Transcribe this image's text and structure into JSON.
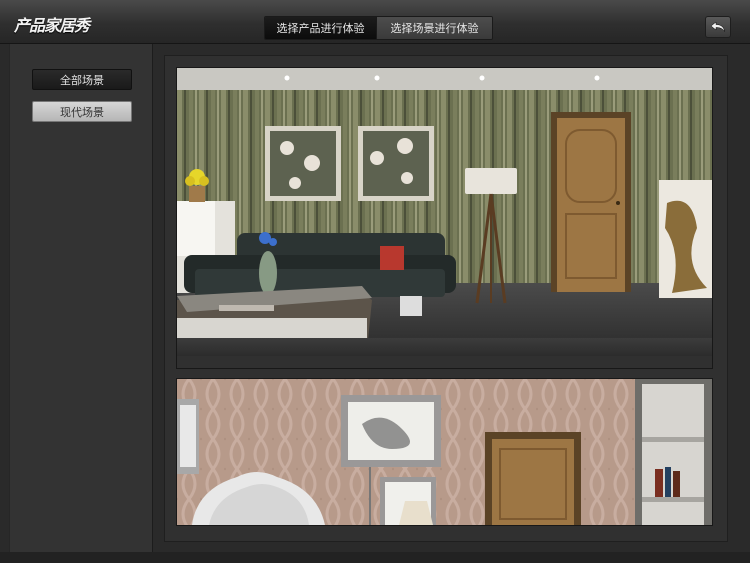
{
  "app": {
    "title": "产品家居秀"
  },
  "header": {
    "tabs": [
      {
        "label": "选择产品进行体验",
        "active": true
      },
      {
        "label": "选择场景进行体验",
        "active": false
      }
    ],
    "back_icon": "back-arrow-icon"
  },
  "sidebar": {
    "items": [
      {
        "label": "全部场景",
        "selected": false
      },
      {
        "label": "现代场景",
        "selected": true
      }
    ]
  },
  "main": {
    "scenes": [
      {
        "name": "living-room-scene"
      },
      {
        "name": "bedroom-scene"
      }
    ]
  },
  "colors": {
    "topbar": "#333333",
    "background": "#2a2a2a",
    "active_tab": "#111111",
    "selected_item": "#c6c6c6"
  }
}
